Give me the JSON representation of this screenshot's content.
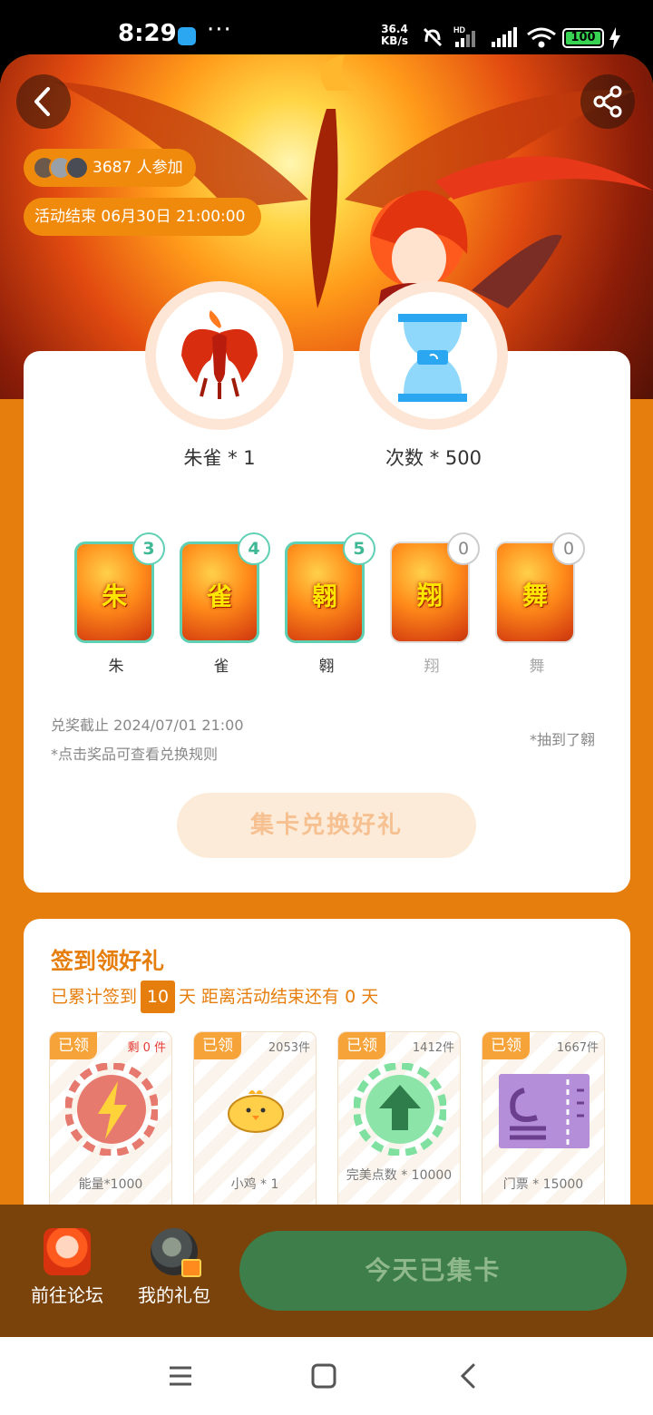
{
  "status_bar": {
    "time": "8:29",
    "more": "···",
    "net_speed_value": "36.4",
    "net_speed_unit": "KB/s",
    "battery": "100"
  },
  "header": {
    "participants": "3687 人参加",
    "ends": "活动结束 06月30日 21:00:00",
    "icons": [
      "back-icon",
      "share-icon"
    ]
  },
  "rewards": [
    {
      "label": "朱雀 * 1",
      "icon": "phoenix-icon"
    },
    {
      "label": "次数 * 500",
      "icon": "hourglass-icon"
    }
  ],
  "cards": [
    {
      "glyph": "朱",
      "name": "朱",
      "count": "3",
      "owned": true
    },
    {
      "glyph": "雀",
      "name": "雀",
      "count": "4",
      "owned": true
    },
    {
      "glyph": "翱",
      "name": "翱",
      "count": "5",
      "owned": true
    },
    {
      "glyph": "翔",
      "name": "翔",
      "count": "0",
      "owned": false
    },
    {
      "glyph": "舞",
      "name": "舞",
      "count": "0",
      "owned": false
    }
  ],
  "exchange": {
    "deadline": "兑奖截止 2024/07/01 21:00",
    "note": "*点击奖品可查看兑换规则",
    "drawn": "*抽到了翱",
    "button": "集卡兑换好礼"
  },
  "signin": {
    "title": "签到领好礼",
    "prefix": "已累计签到",
    "days": "10",
    "suffix": "天  距离活动结束还有 0 天",
    "gifts": [
      {
        "claimed": "已领",
        "remain": "剩 0 件",
        "remain_red": true,
        "name": "能量*1000",
        "icon": "lightning-chip-icon"
      },
      {
        "claimed": "已领",
        "remain": "2053件",
        "remain_red": false,
        "name": "小鸡 * 1",
        "icon": "chick-icon"
      },
      {
        "claimed": "已领",
        "remain": "1412件",
        "remain_red": false,
        "name": "完美点数 * 10000",
        "icon": "arrow-up-chip-icon"
      },
      {
        "claimed": "已领",
        "remain": "1667件",
        "remain_red": false,
        "name": "门票 * 15000",
        "icon": "ticket-icon"
      }
    ]
  },
  "bottom_bar": {
    "forum": "前往论坛",
    "gifts": "我的礼包",
    "collect": "今天已集卡"
  },
  "colors": {
    "accent": "#e67e0d",
    "owned_border": "#5fd0b4",
    "collect_button": "#3d7e4a"
  }
}
